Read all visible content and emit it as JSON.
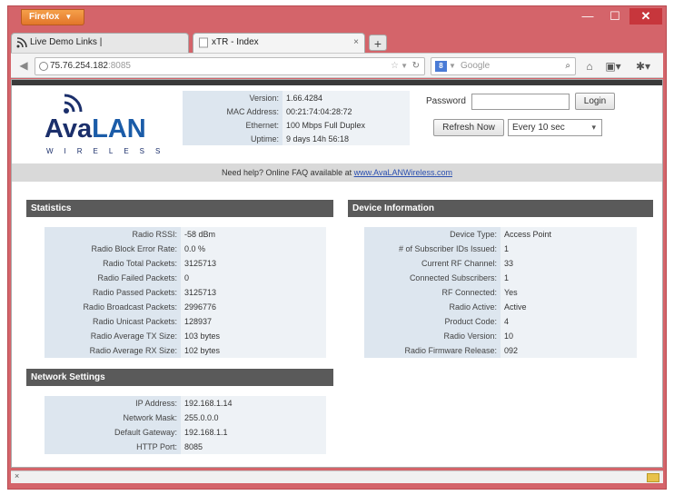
{
  "browser": {
    "menu_button": "Firefox",
    "window_controls": {
      "minimize": "—",
      "maximize": "☐",
      "close": "✕"
    },
    "tabs": [
      {
        "label": "Live Demo Links |",
        "icon": "rss-icon"
      },
      {
        "label": "xTR - Index",
        "icon": "page-icon",
        "close": "×"
      }
    ],
    "new_tab": "+",
    "url": {
      "host": "75.76.254.182",
      "port": ":8085"
    },
    "search_placeholder": "Google"
  },
  "page": {
    "logo": {
      "name_a": "Ava",
      "name_b": "LAN",
      "sub": "WIRELESS"
    },
    "device_summary": [
      {
        "label": "Version:",
        "value": "1.66.4284"
      },
      {
        "label": "MAC Address:",
        "value": "00:21:74:04:28:72"
      },
      {
        "label": "Ethernet:",
        "value": "100 Mbps Full Duplex"
      },
      {
        "label": "Uptime:",
        "value": "9 days 14h 56:18"
      }
    ],
    "password_label": "Password",
    "login_button": "Login",
    "refresh_button": "Refresh Now",
    "refresh_select": "Every 10 sec",
    "help": {
      "text": "Need help?   Online FAQ available at ",
      "link": "www.AvaLANWireless.com"
    },
    "statistics": {
      "title": "Statistics",
      "rows": [
        {
          "label": "Radio RSSI:",
          "value": "-58 dBm"
        },
        {
          "label": "Radio Block Error Rate:",
          "value": "0.0 %"
        },
        {
          "label": "Radio Total Packets:",
          "value": "3125713"
        },
        {
          "label": "Radio Failed Packets:",
          "value": "0"
        },
        {
          "label": "Radio Passed Packets:",
          "value": "3125713"
        },
        {
          "label": "Radio Broadcast Packets:",
          "value": "2996776"
        },
        {
          "label": "Radio Unicast Packets:",
          "value": "128937"
        },
        {
          "label": "Radio Average TX Size:",
          "value": "103 bytes"
        },
        {
          "label": "Radio Average RX Size:",
          "value": "102 bytes"
        }
      ]
    },
    "device_information": {
      "title": "Device Information",
      "rows": [
        {
          "label": "Device Type:",
          "value": "Access Point"
        },
        {
          "label": "# of Subscriber IDs Issued:",
          "value": "1"
        },
        {
          "label": "Current RF Channel:",
          "value": "33"
        },
        {
          "label": "Connected Subscribers:",
          "value": "1"
        },
        {
          "label": "RF Connected:",
          "value": "Yes"
        },
        {
          "label": "Radio Active:",
          "value": "Active"
        },
        {
          "label": "Product Code:",
          "value": "4"
        },
        {
          "label": "Radio Version:",
          "value": "10"
        },
        {
          "label": "Radio Firmware Release:",
          "value": "092"
        }
      ]
    },
    "network_settings": {
      "title": "Network Settings",
      "rows": [
        {
          "label": "IP Address:",
          "value": "192.168.1.14"
        },
        {
          "label": "Network Mask:",
          "value": "255.0.0.0"
        },
        {
          "label": "Default Gateway:",
          "value": "192.168.1.1"
        },
        {
          "label": "HTTP Port:",
          "value": "8085"
        }
      ]
    }
  },
  "statusbar": {
    "close": "×"
  }
}
